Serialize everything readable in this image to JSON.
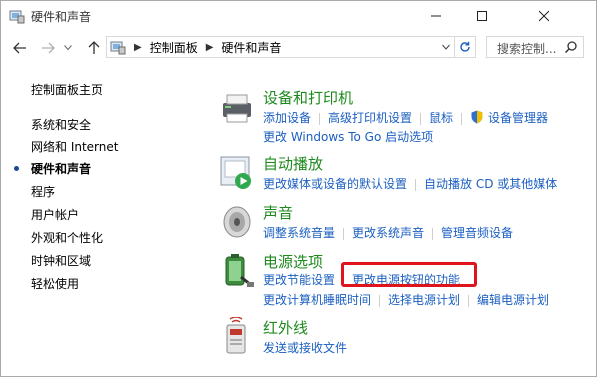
{
  "window": {
    "title": "硬件和声音"
  },
  "address": {
    "crumbs": [
      "控制面板",
      "硬件和声音"
    ],
    "search_placeholder": "搜索控制..."
  },
  "left_nav": {
    "home": "控制面板主页",
    "items": [
      {
        "label": "系统和安全",
        "active": false
      },
      {
        "label": "网络和 Internet",
        "active": false
      },
      {
        "label": "硬件和声音",
        "active": true
      },
      {
        "label": "程序",
        "active": false
      },
      {
        "label": "用户帐户",
        "active": false
      },
      {
        "label": "外观和个性化",
        "active": false
      },
      {
        "label": "时钟和区域",
        "active": false
      },
      {
        "label": "轻松使用",
        "active": false
      }
    ]
  },
  "categories": [
    {
      "title": "设备和打印机",
      "links": [
        [
          "添加设备",
          "高级打印机设置",
          "鼠标",
          "设备管理器"
        ],
        [
          "更改 Windows To Go 启动选项"
        ]
      ]
    },
    {
      "title": "自动播放",
      "links": [
        [
          "更改媒体或设备的默认设置",
          "自动播放 CD 或其他媒体"
        ]
      ]
    },
    {
      "title": "声音",
      "links": [
        [
          "调整系统音量",
          "更改系统声音",
          "管理音频设备"
        ]
      ]
    },
    {
      "title": "电源选项",
      "links": [
        [
          "更改节能设置",
          "更改电源按钮的功能"
        ],
        [
          "更改计算机睡眠时间",
          "选择电源计划",
          "编辑电源计划"
        ]
      ]
    },
    {
      "title": "红外线",
      "links": [
        [
          "发送或接收文件"
        ]
      ]
    }
  ],
  "colors": {
    "link": "#1b5fc1",
    "category_title": "#1e8a1e",
    "highlight": "#e0141c",
    "active_dot": "#1a4d8f"
  }
}
